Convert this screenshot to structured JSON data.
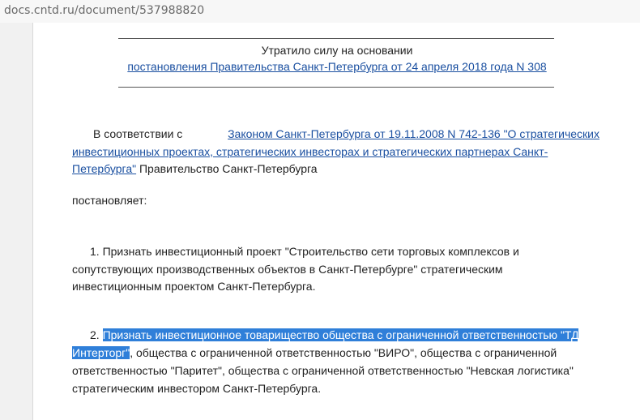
{
  "browser": {
    "url": "docs.cntd.ru/document/537988820"
  },
  "document": {
    "notice_text": "Утратило силу на основании",
    "notice_link": "постановления Правительства Санкт-Петербурга от 24 апреля 2018 года N 308",
    "intro_line1_prefix": "В соответствии с",
    "intro_line1_link": "Законом Санкт-Петербурга от 19.11.2008 N 742-136 \"О стратегических",
    "intro_line2_link": "инвестиционных проектах, стратегических инвесторах и стратегических партнерах Санкт-",
    "intro_line3_link": "Петербурга\"",
    "intro_line3_rest": " Правительство Санкт-Петербурга",
    "resolves": "постановляет:",
    "item1_line1": "1. Признать инвестиционный проект \"Строительство сети торговых комплексов и",
    "item1_line2": "сопутствующих производственных объектов в Санкт-Петербурге\" стратегическим",
    "item1_line3": "инвестиционным проектом Санкт-Петербурга.",
    "item2_line1_num": "2.",
    "item2_line1_highlight": "Признать инвестиционное товарищество общества с ограниченной ответственностью \"ТД",
    "item2_line2_highlight": "Интерторг\"",
    "item2_line2_rest": ", общества с ограниченной ответственностью \"ВИРО\", общества с ограниченной",
    "item2_line3": "ответственностью \"Паритет\", общества с ограниченной ответственностью \"Невская логистика\"",
    "item2_line4": "стратегическим инвестором Санкт-Петербурга."
  }
}
